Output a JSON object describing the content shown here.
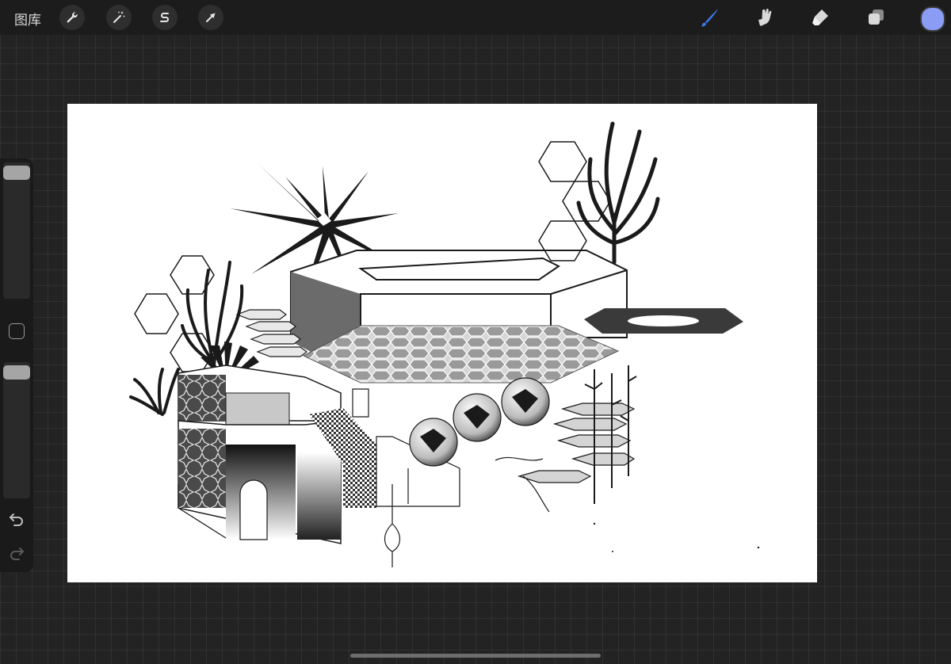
{
  "topbar": {
    "gallery_label": "图库",
    "left_tools": [
      {
        "icon": "wrench-icon",
        "name": "actions-button"
      },
      {
        "icon": "magic-wand-icon",
        "name": "adjustments-button"
      },
      {
        "icon": "selection-s-icon",
        "name": "selection-button"
      },
      {
        "icon": "arrow-cursor-icon",
        "name": "transform-button"
      }
    ],
    "right_tools": [
      {
        "icon": "brush-icon",
        "name": "brush-tool-button",
        "active": true
      },
      {
        "icon": "smudge-icon",
        "name": "smudge-tool-button",
        "active": false
      },
      {
        "icon": "eraser-icon",
        "name": "eraser-tool-button",
        "active": false
      },
      {
        "icon": "layers-icon",
        "name": "layers-button",
        "active": false
      }
    ],
    "current_color": "#8a9cf4",
    "accent_color": "#3d7bf2"
  },
  "sidebar": {
    "brush_size_label": "",
    "opacity_label": "",
    "undo_icon": "undo-icon",
    "redo_icon": "redo-icon"
  }
}
